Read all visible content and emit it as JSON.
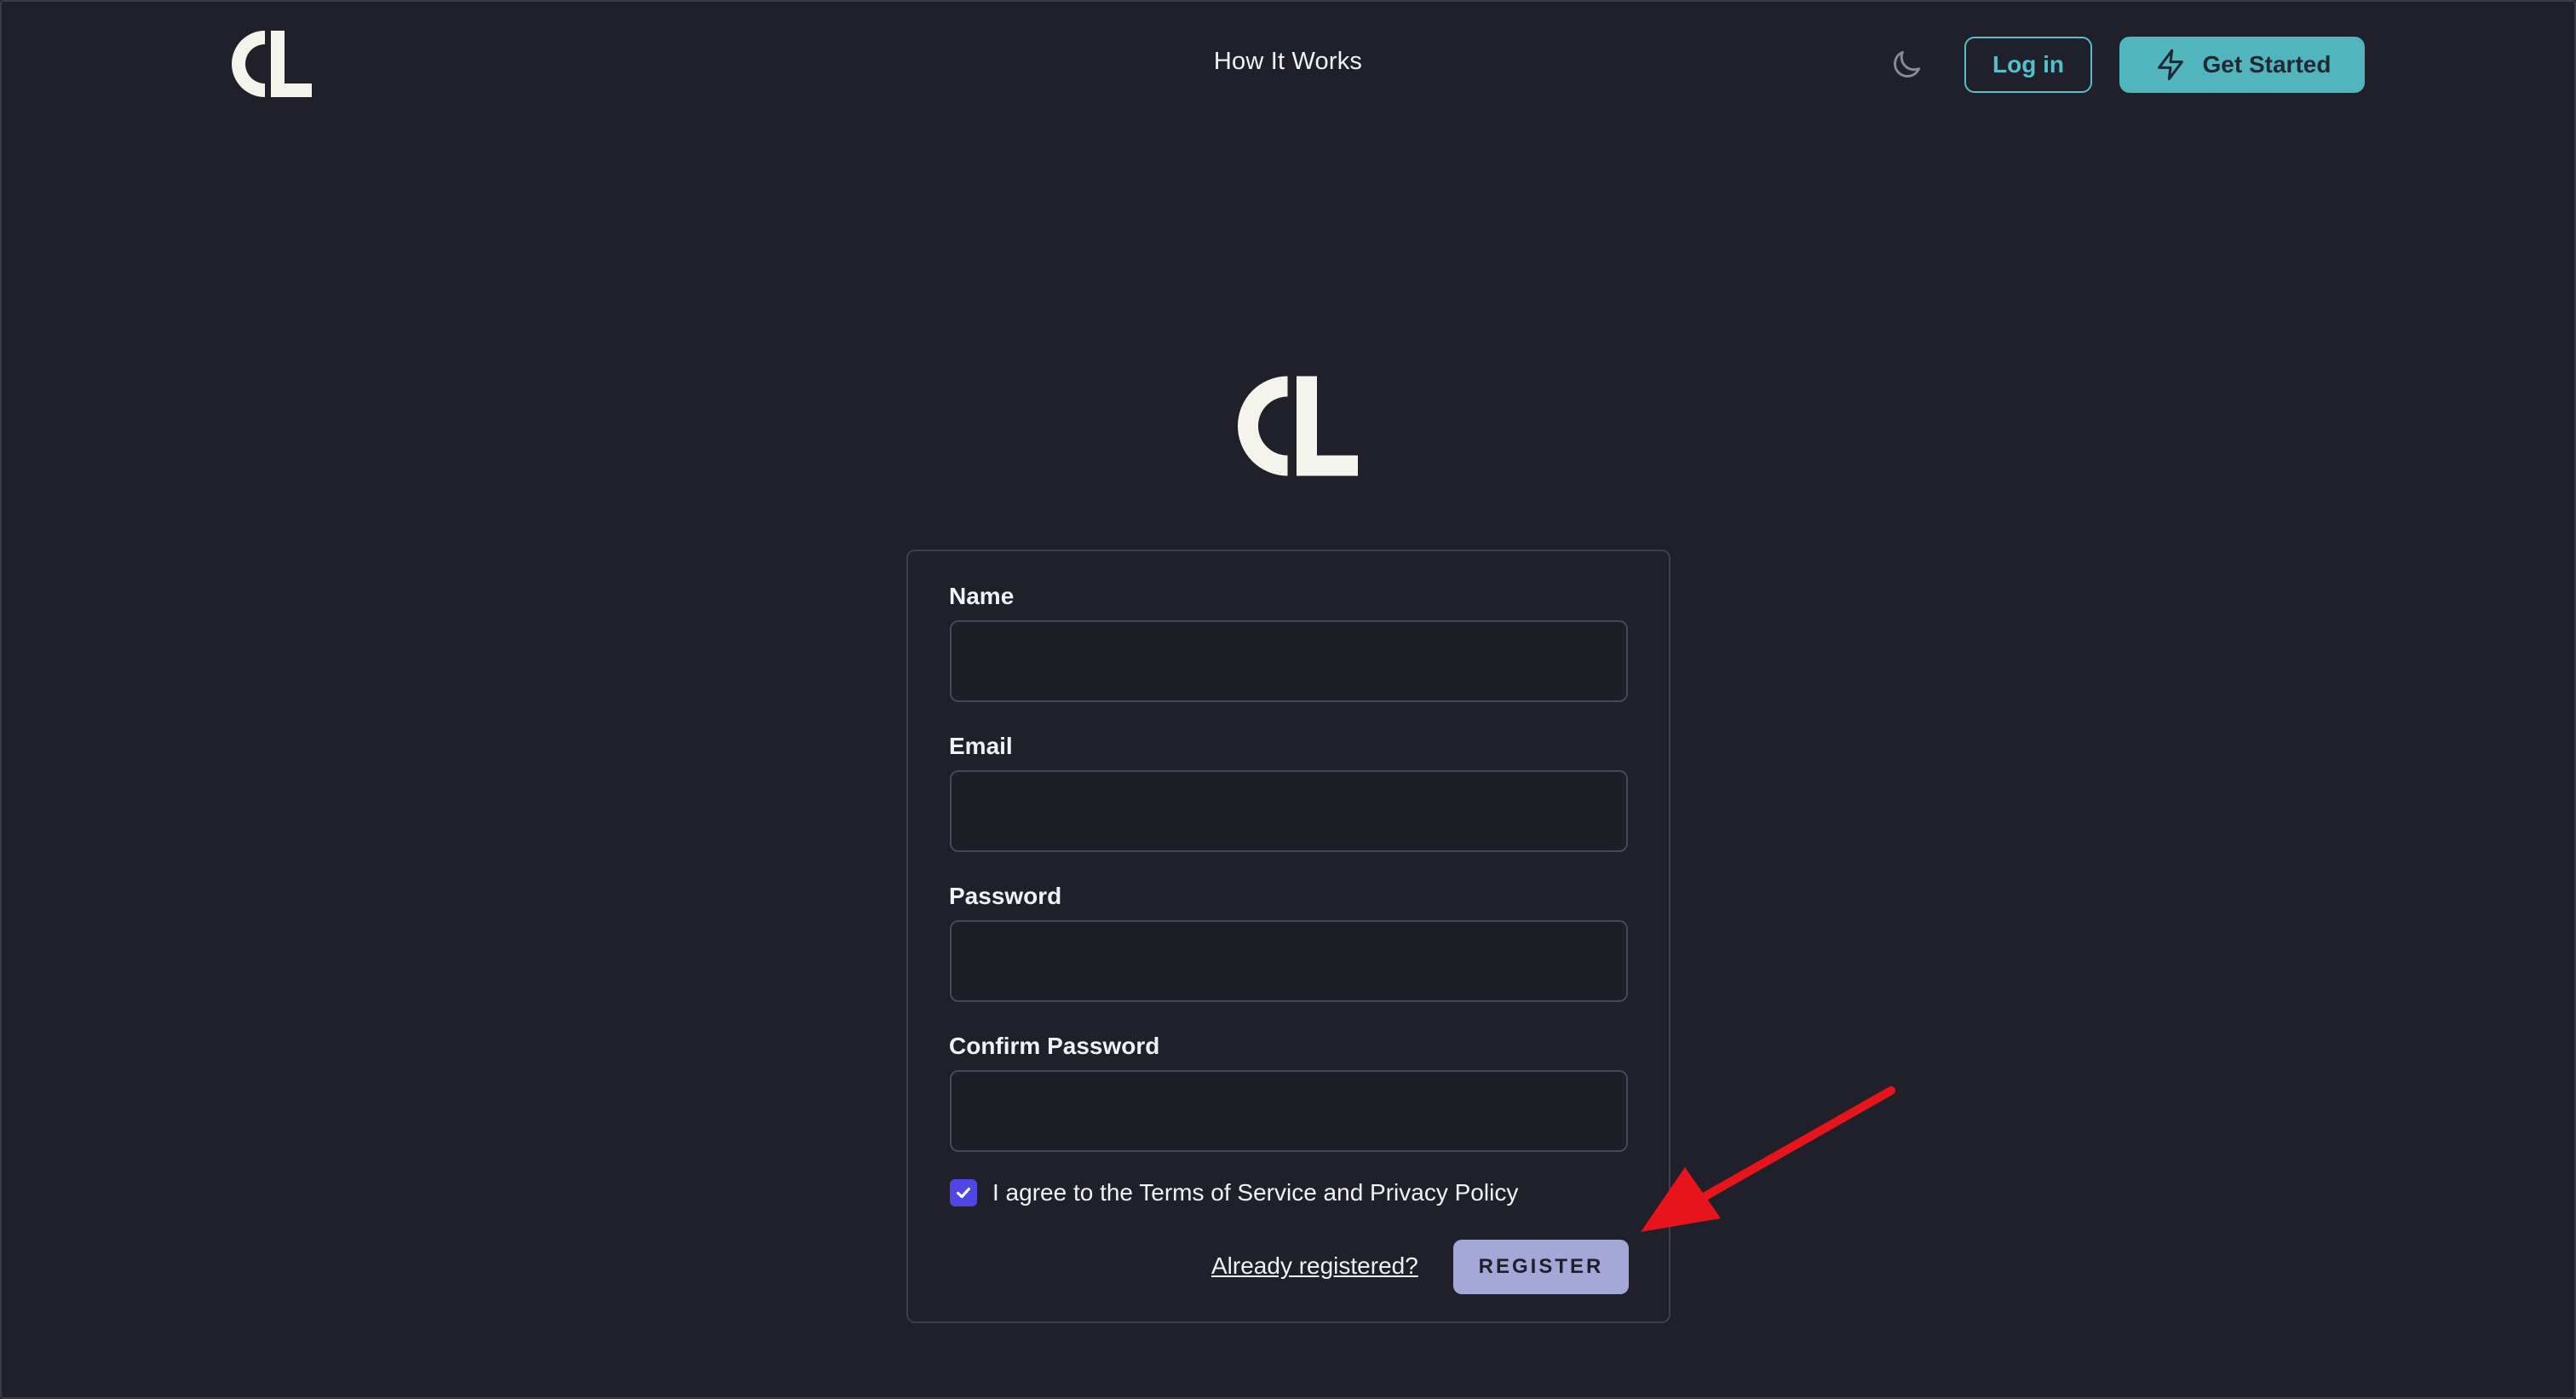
{
  "header": {
    "nav_link": "How It Works",
    "login_label": "Log in",
    "get_started_label": "Get Started",
    "theme_icon": "moon-icon",
    "get_started_icon": "lightning-icon"
  },
  "form": {
    "fields": [
      {
        "label": "Name",
        "value": ""
      },
      {
        "label": "Email",
        "value": ""
      },
      {
        "label": "Password",
        "value": ""
      },
      {
        "label": "Confirm Password",
        "value": ""
      }
    ],
    "agree_checked": true,
    "agree_label": "I agree to the Terms of Service and Privacy Policy",
    "already_registered_label": "Already registered?",
    "register_label": "REGISTER"
  },
  "colors": {
    "background": "#1f2029",
    "accent_teal": "#52b4bd",
    "checkbox": "#4f46e5",
    "register_button": "#a5a8d6",
    "annotation_arrow": "#e8141c"
  }
}
